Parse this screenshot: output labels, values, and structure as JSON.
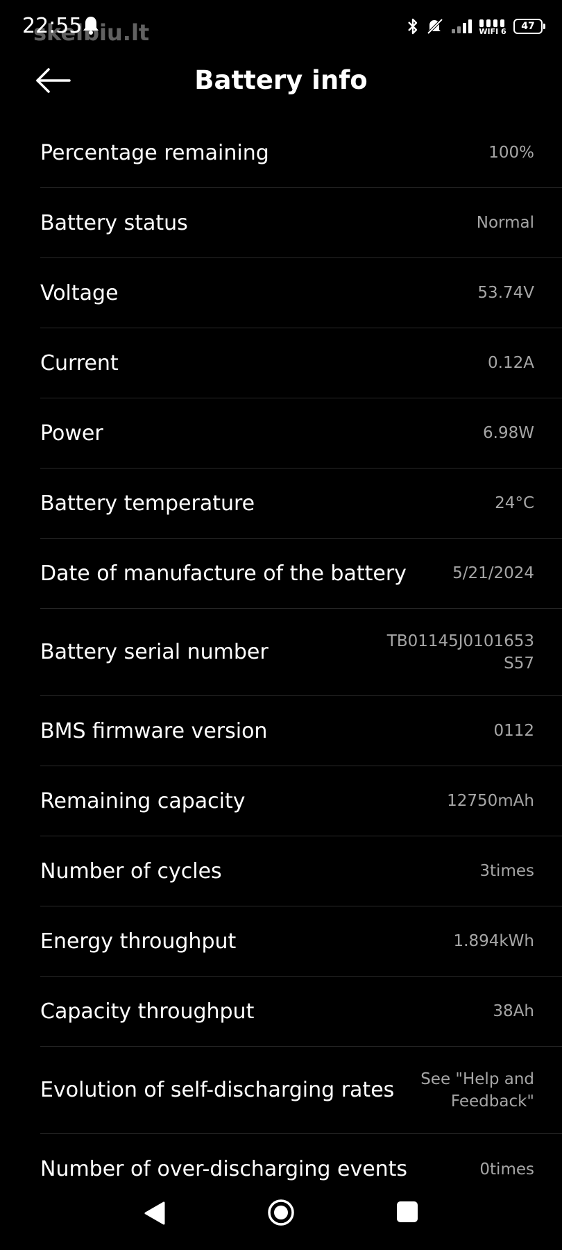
{
  "status_bar": {
    "time": "22:55",
    "watermark": "skelbiu.lt",
    "wifi_label": "WIFI 6",
    "battery_level": "47",
    "icons": [
      "bluetooth-icon",
      "mute-icon",
      "signal-icon",
      "wifi-icon",
      "battery-icon"
    ]
  },
  "header": {
    "back_icon": "arrow-left-icon",
    "title": "Battery info"
  },
  "rows": [
    {
      "label": "Percentage remaining",
      "value": "100%"
    },
    {
      "label": "Battery status",
      "value": "Normal"
    },
    {
      "label": "Voltage",
      "value": "53.74V"
    },
    {
      "label": "Current",
      "value": "0.12A"
    },
    {
      "label": "Power",
      "value": "6.98W"
    },
    {
      "label": "Battery temperature",
      "value": "24°C"
    },
    {
      "label": "Date of manufacture of the battery",
      "value": "5/21/2024"
    },
    {
      "label": "Battery serial number",
      "value": "TB01145J0101653S57"
    },
    {
      "label": "BMS firmware version",
      "value": "0112"
    },
    {
      "label": "Remaining capacity",
      "value": "12750mAh"
    },
    {
      "label": "Number of cycles",
      "value": "3times"
    },
    {
      "label": "Energy throughput",
      "value": "1.894kWh"
    },
    {
      "label": "Capacity throughput",
      "value": "38Ah"
    },
    {
      "label": "Evolution of self-discharging rates",
      "value": "See \"Help and Feedback\""
    },
    {
      "label": "Number of over-discharging events",
      "value": "0times"
    }
  ],
  "nav_bar": {
    "icons": [
      "nav-back-icon",
      "nav-home-icon",
      "nav-recents-icon"
    ]
  },
  "colors": {
    "background": "#000000",
    "text_primary": "#ffffff",
    "text_secondary": "#a6a6a6",
    "divider": "#2a2a2a"
  }
}
